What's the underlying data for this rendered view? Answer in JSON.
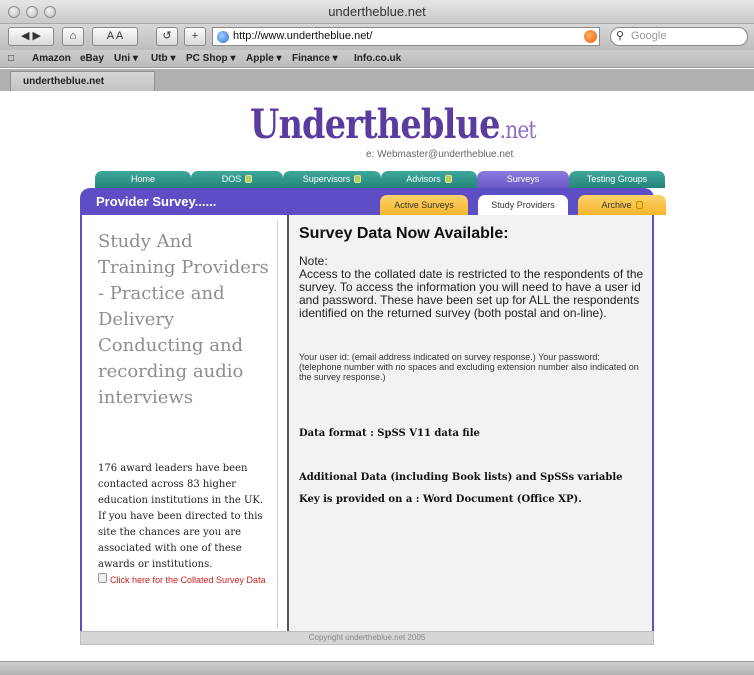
{
  "window": {
    "title": "undertheblue.net"
  },
  "toolbar": {
    "url": "http://www.undertheblue.net/",
    "search_placeholder": "Google",
    "text_size_label": "A A",
    "add_label": "+"
  },
  "bookmarks": [
    "Amazon",
    "eBay",
    "Uni ▾",
    "Utb ▾",
    "PC Shop ▾",
    "Apple ▾",
    "Finance ▾",
    "Info.co.uk"
  ],
  "tab": {
    "label": "undertheblue.net"
  },
  "site": {
    "logo_main": "Undertheblue",
    "logo_ext": ".net",
    "email": "e: Webmaster@undertheblue.net"
  },
  "nav": [
    "Home",
    "DOS",
    "Supervisors",
    "Advisors",
    "Surveys",
    "Testing Groups"
  ],
  "section": {
    "title": "Provider Survey......",
    "subtabs": [
      "Active Surveys",
      "Study Providers",
      "Archive"
    ]
  },
  "left": {
    "lead": "Study And Training Providers - Practice and Delivery Conducting and recording audio interviews",
    "blurb": "176 award leaders have been contacted across 83 higher education institutions in the UK. If you have been directed to this site the chances are you are associated with one of these awards or institutions.",
    "link": "Click here for the Collated Survey Data"
  },
  "right": {
    "title": "Survey Data Now Available:",
    "note_label": "Note:",
    "note": "Access to the collated date is restricted to the respondents of the survey. To access the information you will need to have a user id and password. These have been set up for ALL the respondents identified on the returned survey (both postal and on-line).",
    "small": "Your user id: (email address indicated on survey response.) Your password: (telephone number with no spaces and excluding extension number also indicated on the survey response.)",
    "format": "Data format : SpSS V11 data file",
    "additional": "Additional Data (including Book lists) and SpSSs variable Key is provided on a : Word Document (Office XP)."
  },
  "footer": {
    "text": "Copyright undertheblue.net 2005"
  },
  "colors": {
    "nav_teal": "#24857a",
    "nav_active": "#6b58c8",
    "band": "#5d4ec5",
    "subtab": "#f4b52b"
  }
}
